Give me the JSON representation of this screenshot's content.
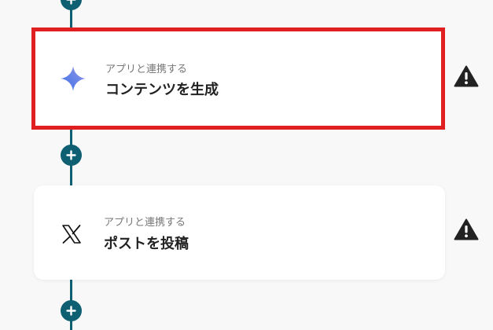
{
  "steps": [
    {
      "subtitle": "アプリと連携する",
      "title": "コンテンツを生成",
      "icon": "gemini-sparkle-icon",
      "selected": true,
      "status_icon": "warning-icon"
    },
    {
      "subtitle": "アプリと連携する",
      "title": "ポストを投稿",
      "icon": "x-logo-icon",
      "selected": false,
      "status_icon": "warning-icon"
    }
  ],
  "add_button_icon": "plus-icon",
  "colors": {
    "connector": "#0e5f72",
    "selection_border": "#e02020",
    "warning": "#222222",
    "background": "#f8f8f8"
  }
}
